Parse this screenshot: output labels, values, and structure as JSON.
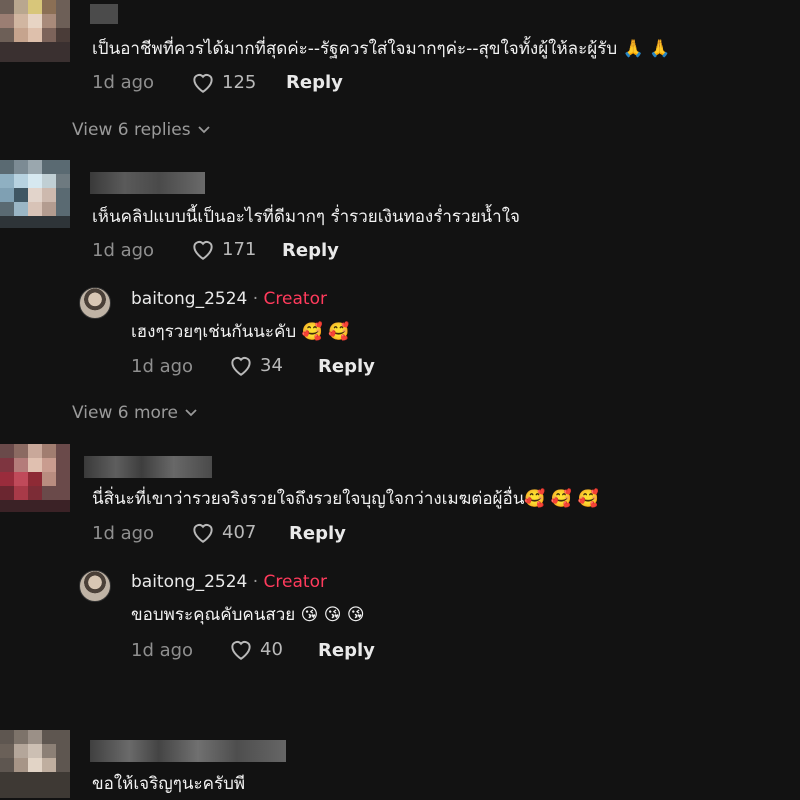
{
  "comments": [
    {
      "text": "เป็นอาชีพที่ควรได้มากที่สุดค่ะ--รัฐควรใส่ใจมากๆค่ะ--สุขใจทั้งผู้ให้ละผู้รับ 🙏 🙏",
      "time": "1d ago",
      "likes": "125",
      "reply_label": "Reply",
      "view_replies": "View 6 replies"
    },
    {
      "text": "เห็นคลิปแบบนี้เป็นอะไรที่ดีมากๆ ร่ำรวยเงินทองร่ำรวยน้ำใจ",
      "time": "1d ago",
      "likes": "171",
      "reply_label": "Reply",
      "creator_reply": {
        "username": "baitong_2524",
        "separator": "·",
        "badge": "Creator",
        "text": "เฮงๆรวยๆเช่นกันนะคับ 🥰 🥰",
        "time": "1d ago",
        "likes": "34",
        "reply_label": "Reply"
      },
      "view_more": "View 6 more"
    },
    {
      "text": "นี่สิ่นะที่เขาว่ารวยจริงรวยใจถึงรวยใจบุญใจกว่างเมฆต่อผู้อื่น🥰 🥰 🥰",
      "time": "1d ago",
      "likes": "407",
      "reply_label": "Reply",
      "creator_reply": {
        "username": "baitong_2524",
        "separator": "·",
        "badge": "Creator",
        "text": "ขอบพระคุณคับคนสวย 😘 😘 😘",
        "time": "1d ago",
        "likes": "40",
        "reply_label": "Reply"
      }
    },
    {
      "text": "ขอให้เจริญๆนะครับพี"
    }
  ],
  "colors": {
    "background": "#121212",
    "creator_badge": "#ff3b5c",
    "meta_text": "#8f8f8f"
  }
}
